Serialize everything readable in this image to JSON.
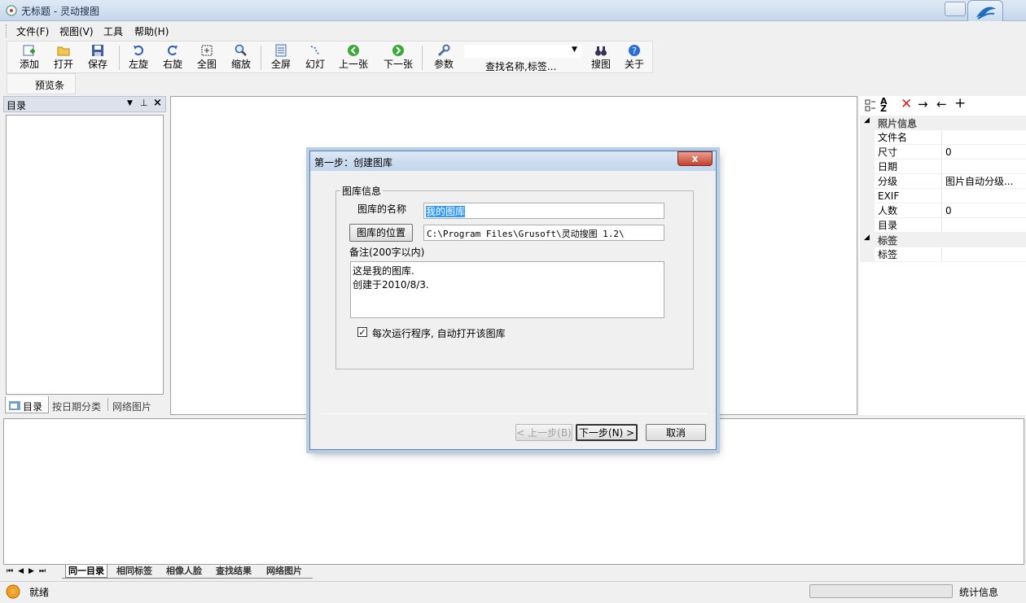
{
  "window": {
    "title": "无标题 - 灵动搜图"
  },
  "menu": [
    "文件(F)",
    "视图(V)",
    "工具",
    "帮助(H)"
  ],
  "toolbar": {
    "buttons": [
      {
        "label": "添加",
        "icon": "add-icon"
      },
      {
        "label": "打开",
        "icon": "folder-open-icon"
      },
      {
        "label": "保存",
        "icon": "save-icon"
      },
      {
        "label": "左旋",
        "icon": "rotate-left-icon"
      },
      {
        "label": "右旋",
        "icon": "rotate-right-icon"
      },
      {
        "label": "全图",
        "icon": "fit-icon"
      },
      {
        "label": "缩放",
        "icon": "zoom-icon"
      },
      {
        "label": "全屏",
        "icon": "fullscreen-icon"
      },
      {
        "label": "幻灯",
        "icon": "slideshow-icon"
      },
      {
        "label": "上一张",
        "icon": "prev-icon"
      },
      {
        "label": "下一张",
        "icon": "next-icon"
      },
      {
        "label": "参数",
        "icon": "wrench-icon"
      },
      {
        "label": "搜图",
        "icon": "binoculars-icon"
      },
      {
        "label": "关于",
        "icon": "help-icon"
      }
    ],
    "search_label": "查找名称,标签...",
    "preview_bar": "预览条"
  },
  "left_panel": {
    "title": "目录",
    "tabs": [
      "目录",
      "按日期分类",
      "网络图片"
    ]
  },
  "dialog": {
    "title": "第一步：创建图库",
    "close": "x",
    "group_title": "图库信息",
    "name_label": "图库的名称",
    "name_value": "我的图库",
    "location_button": "图库的位置",
    "location_value": "C:\\Program Files\\Grusoft\\灵动搜图 1.2\\",
    "note_label": "备注(200字以内)",
    "note_line1": "这是我的图库.",
    "note_line2": "创建于2010/8/3.",
    "checkbox_checked": true,
    "checkbox_label": "每次运行程序, 自动打开该图库",
    "prev_button": "< 上一步(B)",
    "next_button": "下一步(N) >",
    "cancel_button": "取消"
  },
  "properties": {
    "section_photo": "照片信息",
    "rows": [
      {
        "name": "文件名",
        "value": ""
      },
      {
        "name": "尺寸",
        "value": "0"
      },
      {
        "name": "日期",
        "value": ""
      },
      {
        "name": "分级",
        "value": "图片自动分级..."
      },
      {
        "name": "EXIF",
        "value": ""
      },
      {
        "name": "人数",
        "value": "0"
      },
      {
        "name": "目录",
        "value": ""
      }
    ],
    "section_tags": "标签",
    "tag_row": "标签"
  },
  "bottom_tabs": [
    "同一目录",
    "相同标签",
    "相像人脸",
    "查找结果",
    "网络图片"
  ],
  "status": {
    "text": "就绪",
    "stats": "统计信息",
    "progress": 0
  }
}
